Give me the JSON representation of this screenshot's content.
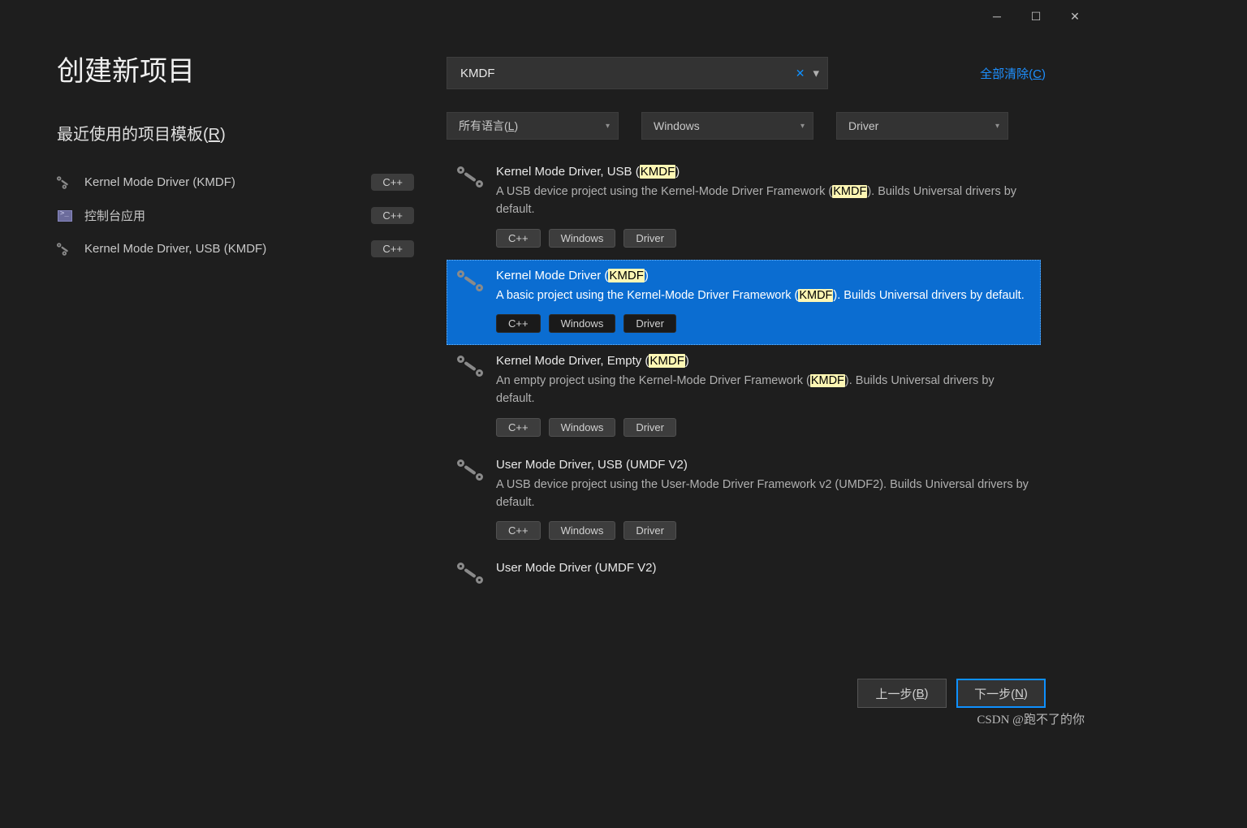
{
  "titlebar": {
    "minimize": "─",
    "maximize": "☐",
    "close": "✕"
  },
  "page_title": "创建新项目",
  "recent_heading_pre": "最近使用的项目模板(",
  "recent_heading_key": "R",
  "recent_heading_post": ")",
  "recent": [
    {
      "icon": "driver",
      "name": "Kernel Mode Driver (KMDF)",
      "lang": "C++"
    },
    {
      "icon": "console",
      "name": "控制台应用",
      "lang": "C++"
    },
    {
      "icon": "driver",
      "name": "Kernel Mode Driver, USB (KMDF)",
      "lang": "C++"
    }
  ],
  "search": {
    "value": "KMDF",
    "clear_icon": "✕",
    "chevron": "▾"
  },
  "clear_all_pre": "全部清除(",
  "clear_all_key": "C",
  "clear_all_post": ")",
  "filters": {
    "lang_pre": "所有语言(",
    "lang_key": "L",
    "lang_post": ")",
    "platform": "Windows",
    "type": "Driver",
    "chevron": "▾"
  },
  "templates": [
    {
      "title_pre": "Kernel Mode Driver, USB (",
      "title_hl": "KMDF",
      "title_post": ")",
      "desc_pre": "A USB device project using the Kernel-Mode Driver Framework (",
      "desc_hl": "KMDF",
      "desc_post": "). Builds Universal drivers by default.",
      "tags": [
        "C++",
        "Windows",
        "Driver"
      ],
      "selected": false
    },
    {
      "title_pre": "Kernel Mode Driver (",
      "title_hl": "KMDF",
      "title_post": ")",
      "desc_pre": "A basic project using the Kernel-Mode Driver Framework (",
      "desc_hl": "KMDF",
      "desc_post": "). Builds Universal drivers by default.",
      "tags": [
        "C++",
        "Windows",
        "Driver"
      ],
      "selected": true
    },
    {
      "title_pre": "Kernel Mode Driver, Empty (",
      "title_hl": "KMDF",
      "title_post": ")",
      "desc_pre": "An empty project using the Kernel-Mode Driver Framework (",
      "desc_hl": "KMDF",
      "desc_post": "). Builds Universal drivers by default.",
      "tags": [
        "C++",
        "Windows",
        "Driver"
      ],
      "selected": false
    },
    {
      "title_pre": "User Mode Driver, USB (UMDF V2)",
      "title_hl": "",
      "title_post": "",
      "desc_pre": "A USB device project using the User-Mode Driver Framework v2 (UMDF2). Builds Universal drivers by default.",
      "desc_hl": "",
      "desc_post": "",
      "tags": [
        "C++",
        "Windows",
        "Driver"
      ],
      "selected": false
    },
    {
      "title_pre": "User Mode Driver (UMDF V2)",
      "title_hl": "",
      "title_post": "",
      "desc_pre": "",
      "desc_hl": "",
      "desc_post": "",
      "tags": [],
      "selected": false
    }
  ],
  "footer": {
    "back_pre": "上一步(",
    "back_key": "B",
    "back_post": ")",
    "next_pre": "下一步(",
    "next_key": "N",
    "next_post": ")"
  },
  "watermark": "CSDN @跑不了的你"
}
